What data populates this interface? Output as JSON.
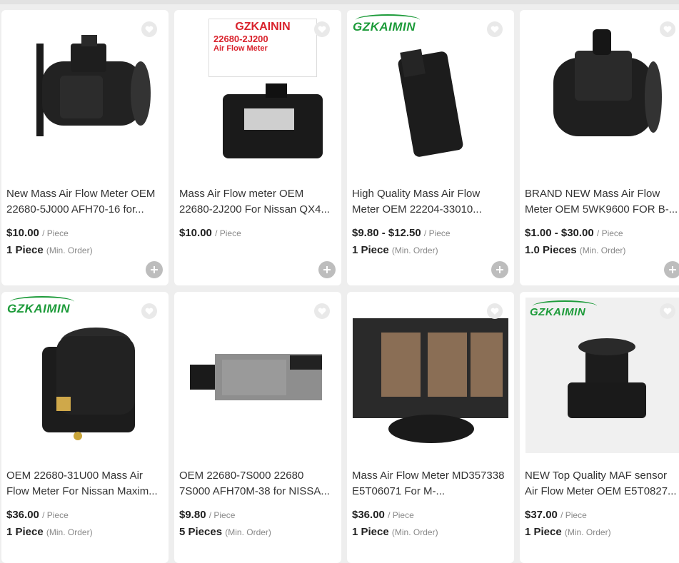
{
  "products": [
    {
      "title": "New Mass Air Flow Meter OEM 22680-5J000 AFH70-16 for...",
      "price": "$10.00",
      "unit": "/ Piece",
      "moq": "1 Piece",
      "moq_label": "(Min. Order)",
      "logo": "",
      "image": "maf-sensor-round"
    },
    {
      "title": "Mass Air Flow meter OEM 22680-2J200 For Nissan QX4...",
      "price": "$10.00",
      "unit": "/ Piece",
      "moq": "",
      "moq_label": "",
      "logo": "",
      "image": "maf-sensor-box",
      "label_brand": "GZKAININ",
      "label_part": "22680-2J200",
      "label_name": "Air Flow Meter"
    },
    {
      "title": "High Quality Mass Air Flow Meter OEM 22204-33010...",
      "price": "$9.80 - $12.50",
      "unit": "/ Piece",
      "moq": "1 Piece",
      "moq_label": "(Min. Order)",
      "logo": "GZKAIMIN",
      "image": "maf-sensor-plug"
    },
    {
      "title": "BRAND NEW Mass Air Flow Meter OEM 5WK9600 FOR B-...",
      "price": "$1.00 - $30.00",
      "unit": "/ Piece",
      "moq": "1.0 Pieces",
      "moq_label": "(Min. Order)",
      "logo": "",
      "image": "maf-sensor-round"
    },
    {
      "title": "OEM 22680-31U00 Mass Air Flow Meter For Nissan Maxim...",
      "price": "$36.00",
      "unit": "/ Piece",
      "moq": "1 Piece",
      "moq_label": "(Min. Order)",
      "logo": "GZKAIMIN",
      "image": "maf-sensor-tube"
    },
    {
      "title": "OEM 22680-7S000 22680 7S000 AFH70M-38 for NISSA...",
      "price": "$9.80",
      "unit": "/ Piece",
      "moq": "5 Pieces",
      "moq_label": "(Min. Order)",
      "logo": "",
      "image": "maf-sensor-flat"
    },
    {
      "title": "Mass Air Flow Meter MD357338 E5T06071 For M-...",
      "price": "$36.00",
      "unit": "/ Piece",
      "moq": "1 Piece",
      "moq_label": "(Min. Order)",
      "logo": "",
      "image": "maf-sensor-mesh"
    },
    {
      "title": "NEW Top Quality MAF sensor Air Flow Meter OEM E5T0827...",
      "price": "$37.00",
      "unit": "/ Piece",
      "moq": "1 Piece",
      "moq_label": "(Min. Order)",
      "logo": "GZKAIMIN",
      "image": "maf-sensor-tube"
    }
  ],
  "icons": {
    "favorite": "heart-icon",
    "add": "plus-icon"
  },
  "colors": {
    "logo_green": "#1d9b3a",
    "price_text": "#222222",
    "muted_text": "#888888",
    "card_bg": "#ffffff",
    "page_bg": "#eeeeee"
  }
}
